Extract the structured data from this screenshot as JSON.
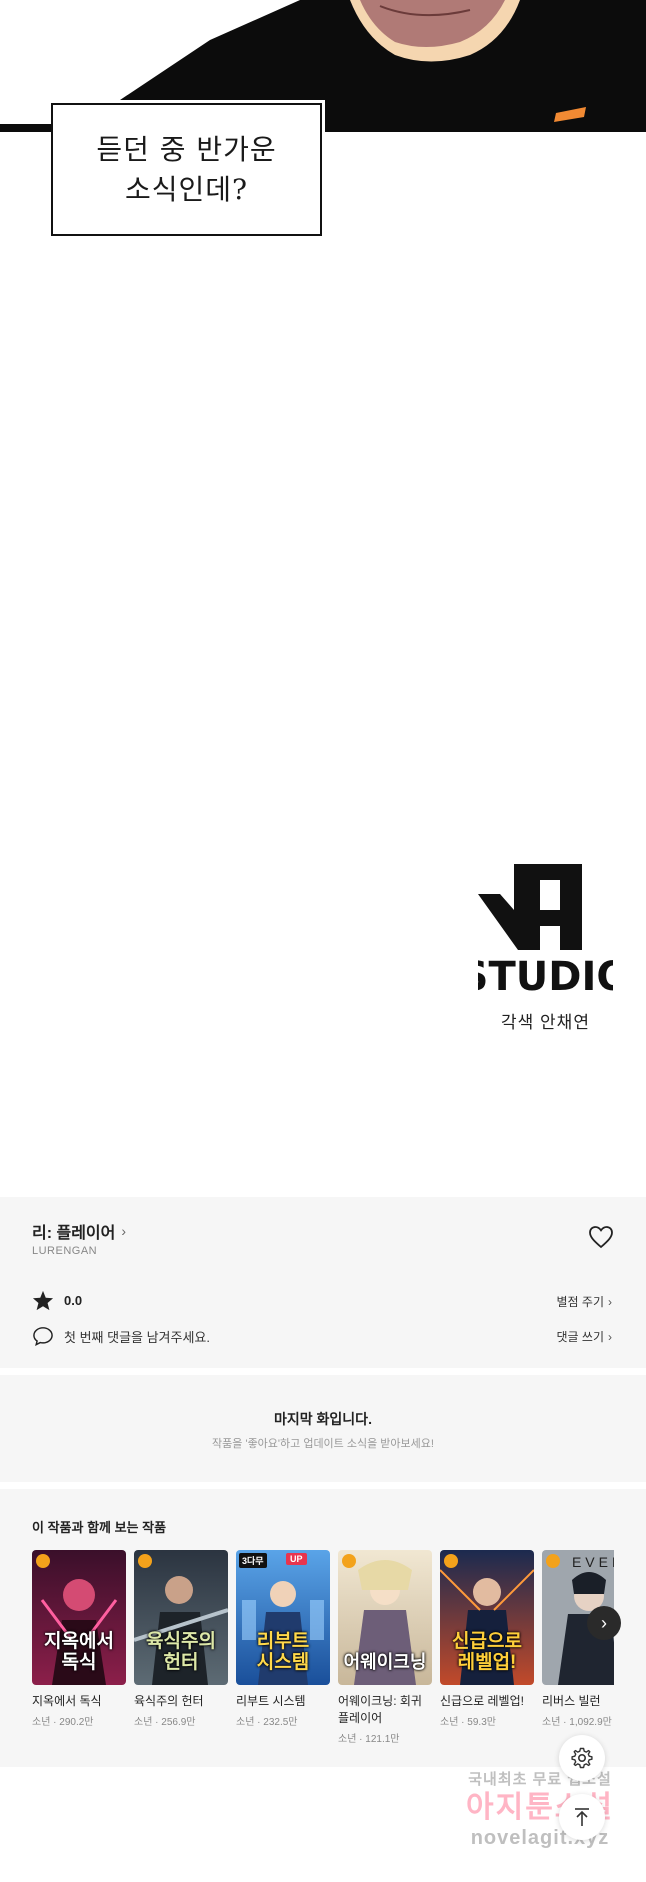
{
  "comic": {
    "speech_line1": "듣던 중 반가운",
    "speech_line2": "소식인데?",
    "logo_text": "STUDIO",
    "credit": "각색  안채연"
  },
  "series": {
    "title": "리: 플레이어",
    "author": "LURENGAN",
    "rating": "0.0",
    "comment_prompt": "첫 번째 댓글을 남겨주세요.",
    "rate_link": "별점 주기",
    "comment_link": "댓글 쓰기"
  },
  "last_episode": {
    "title": "마지막 화입니다.",
    "subtitle": "작품을 '좋아요'하고 업데이트 소식을 받아보세요!"
  },
  "recommendations": {
    "title": "이 작품과 함께 보는 작품",
    "items": [
      {
        "name": "지옥에서 독식",
        "meta": "소년 · 290.2만",
        "cover_text": "지옥에서\n독식",
        "badge": "clock"
      },
      {
        "name": "육식주의 헌터",
        "meta": "소년 · 256.9만",
        "cover_text": "육식주의\n헌터",
        "badge": "clock"
      },
      {
        "name": "리부트 시스템",
        "meta": "소년 · 232.5만",
        "cover_text": "리부트\n시스템",
        "badge": "3다무",
        "badge_up": "UP"
      },
      {
        "name": "어웨이크닝: 회귀 플레이어",
        "meta": "소년 · 121.1만",
        "cover_text": "어웨이크닝",
        "badge": "clock"
      },
      {
        "name": "신급으로 레벨업!",
        "meta": "소년 · 59.3만",
        "cover_text": "신급으로\n레벨업!",
        "badge": "clock"
      },
      {
        "name": "리버스 빌런",
        "meta": "소년 · 1,092.9만",
        "cover_text": "EVER",
        "badge": "clock"
      }
    ]
  },
  "watermark": {
    "line1": "국내최초 무료 웹소설",
    "line2": "아지툰소설",
    "line3": "novelagit.xyz"
  },
  "colors": {
    "section_bg": "#f6f6f6",
    "accent_orange": "#f3a21b",
    "badge_red": "#e8344e",
    "ink": "#111111"
  },
  "icons": {
    "heart": "heart-icon",
    "star": "star-icon",
    "comment": "speech-bubble-icon",
    "next": "chevron-right-icon",
    "settings": "gear-icon",
    "top": "arrow-up-icon"
  }
}
